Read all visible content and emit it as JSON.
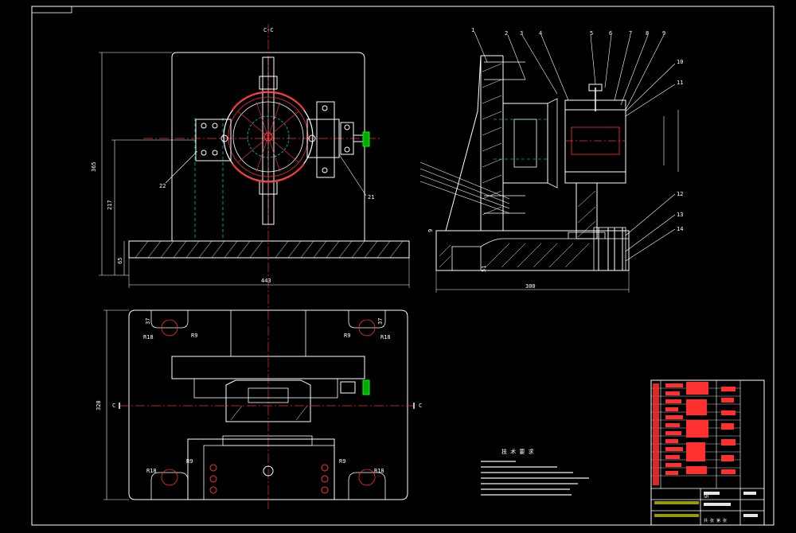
{
  "drawing": {
    "section_top": "C-C",
    "section_left": "C",
    "section_right": "C",
    "dimensions": {
      "front_overall_height": "365",
      "front_mid_height": "217",
      "front_base_height": "65",
      "front_width": "443",
      "side_width": "300",
      "side_height_a": "9",
      "side_height_b": "51",
      "top_height": "320",
      "radius_r18": "R18",
      "radius_r9": "R9",
      "offset_37": "37"
    },
    "balloons": [
      "1",
      "2",
      "3",
      "4",
      "5",
      "6",
      "7",
      "8",
      "9",
      "10",
      "11",
      "12",
      "13",
      "14",
      "21",
      "22"
    ],
    "notes_title": "技 术 要 求",
    "title_block": {
      "doc_code": "SH",
      "scale_label": "比例",
      "sheet_label": "共 张 第 张"
    }
  },
  "colors": {
    "background": "#000000",
    "outline": "#ffffff",
    "hidden": "#00ffff",
    "center": "#ff3030",
    "accent": "#ffff00",
    "green": "#00ff00"
  }
}
